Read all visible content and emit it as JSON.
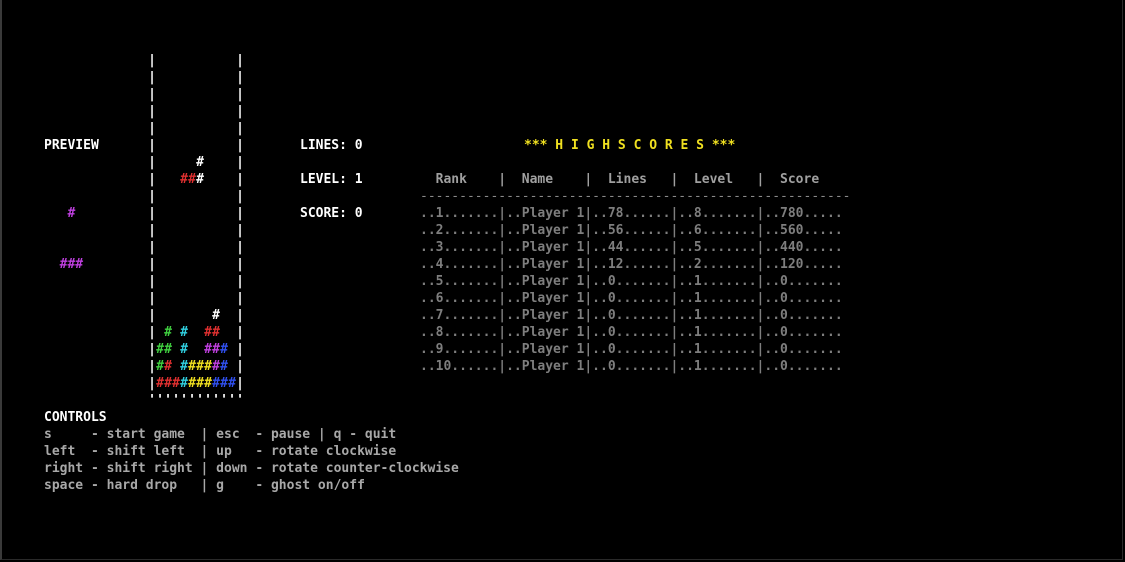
{
  "preview": {
    "label": "PREVIEW",
    "piece_lines": [
      "   #",
      "  ###"
    ],
    "color": "#c040e0"
  },
  "board": {
    "rows": [
      "|          |",
      "|          |",
      "|          |",
      "|          |",
      "|          |",
      "|          |",
      "|     #    |",
      "|   ###    |",
      "|          |",
      "|          |",
      "|          |",
      "|          |",
      "|          |",
      "|          |",
      "|          |",
      "|       #  |",
      "| # #  ##  |",
      "|## #  ### |",
      "|## ###### |",
      "|##########|",
      "''''''''''''"
    ],
    "colors": {
      "red": "#e03030",
      "green": "#40d040",
      "cyan": "#30d0e0",
      "yellow": "#f0e020",
      "magenta": "#c040e0",
      "blue": "#3050f0",
      "border": "#ffffff"
    }
  },
  "stats": {
    "lines": "LINES: 0",
    "level": "LEVEL: 1",
    "score": "SCORE: 0"
  },
  "highscores": {
    "title": "*** H I G H S C O R E S ***",
    "header": "  Rank    |  Name    |  Lines   |  Level   |  Score",
    "separator": "-------------------------------------------------------",
    "rows": [
      "..1.......|..Player 1|..78......|..8.......|..780.....",
      "..2.......|..Player 1|..56......|..6.......|..560.....",
      "..3.......|..Player 1|..44......|..5.......|..440.....",
      "..4.......|..Player 1|..12......|..2.......|..120.....",
      "..5.......|..Player 1|..0.......|..1.......|..0.......",
      "..6.......|..Player 1|..0.......|..1.......|..0.......",
      "..7.......|..Player 1|..0.......|..1.......|..0.......",
      "..8.......|..Player 1|..0.......|..1.......|..0.......",
      "..9.......|..Player 1|..0.......|..1.......|..0.......",
      "..10......|..Player 1|..0.......|..1.......|..0......."
    ]
  },
  "controls": {
    "title": "CONTROLS",
    "lines": [
      "s     - start game  | esc  - pause | q - quit",
      "left  - shift left  | up   - rotate clockwise",
      "right - shift right | down - rotate counter-clockwise",
      "space - hard drop   | g    - ghost on/off"
    ]
  }
}
